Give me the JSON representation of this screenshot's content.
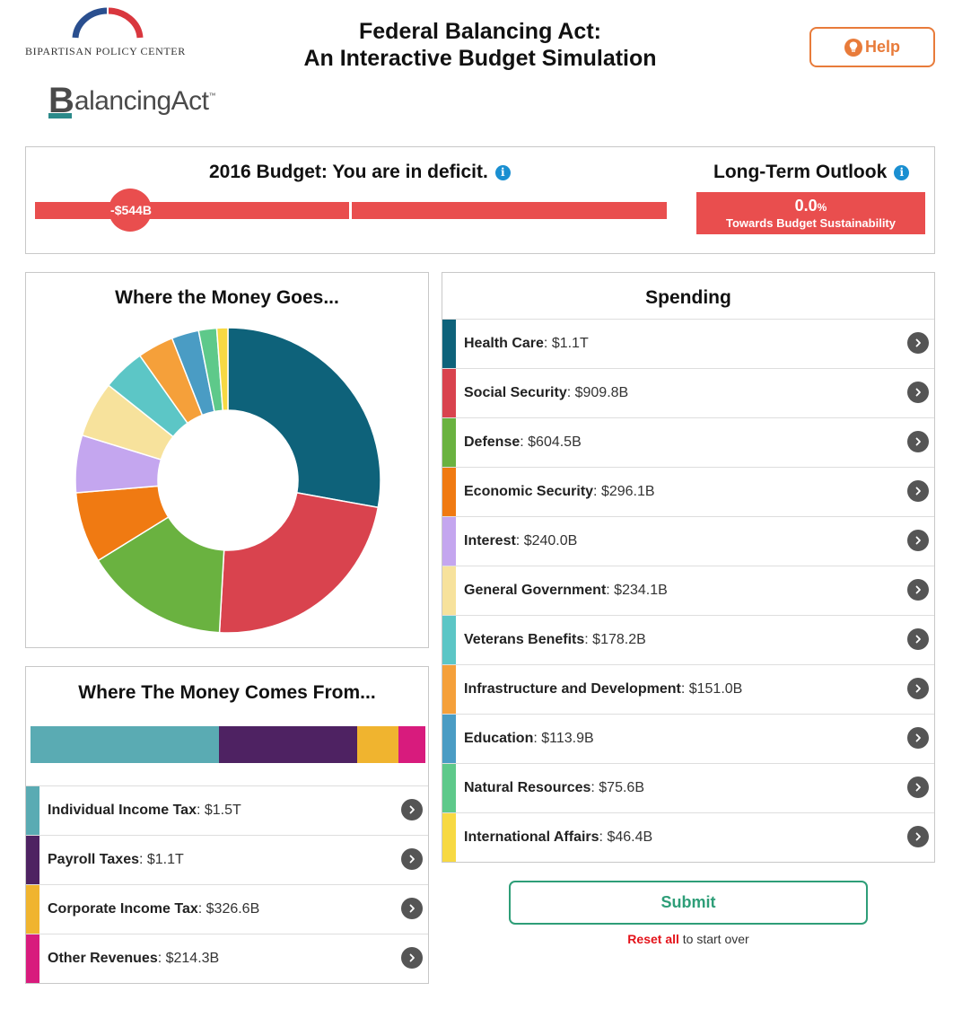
{
  "header": {
    "org_name": "BIPARTISAN POLICY CENTER",
    "product_logo_text": "BalancingAct",
    "title_line1": "Federal Balancing Act:",
    "title_line2": "An Interactive Budget Simulation",
    "help_label": "Help",
    "help_icon": "lightbulb-icon",
    "colors": {
      "arc_blue": "#2a4f8f",
      "arc_red": "#d9373e",
      "help_orange": "#e87b3a"
    }
  },
  "budget": {
    "title": "2016 Budget: You are in deficit.",
    "deficit_label": "-$544B",
    "info_icon": "info-icon",
    "bar_color": "#e94e4e"
  },
  "outlook": {
    "title": "Long-Term Outlook",
    "value": "0.0",
    "unit": "%",
    "subtitle": "Towards Budget Sustainability",
    "info_icon": "info-icon"
  },
  "where_goes": {
    "title": "Where the Money Goes..."
  },
  "where_from": {
    "title": "Where The Money Comes From...",
    "items": [
      {
        "name": "Individual Income Tax",
        "amount": ": $1.5T",
        "color": "#5aabb3",
        "value": 1500
      },
      {
        "name": "Payroll Taxes",
        "amount": ": $1.1T",
        "color": "#4e2262",
        "value": 1100
      },
      {
        "name": "Corporate Income Tax",
        "amount": ": $326.6B",
        "color": "#f0b42f",
        "value": 326.6
      },
      {
        "name": "Other Revenues",
        "amount": ": $214.3B",
        "color": "#d81b7d",
        "value": 214.3
      }
    ]
  },
  "spending": {
    "title": "Spending",
    "items": [
      {
        "name": "Health Care",
        "amount": ": $1.1T",
        "color": "#0e627a",
        "value": 1100
      },
      {
        "name": "Social Security",
        "amount": ": $909.8B",
        "color": "#d9434e",
        "value": 909.8
      },
      {
        "name": "Defense",
        "amount": ": $604.5B",
        "color": "#6ab240",
        "value": 604.5
      },
      {
        "name": "Economic Security",
        "amount": ": $296.1B",
        "color": "#f07a12",
        "value": 296.1
      },
      {
        "name": "Interest",
        "amount": ": $240.0B",
        "color": "#c4a6ef",
        "value": 240.0
      },
      {
        "name": "General Government",
        "amount": ": $234.1B",
        "color": "#f7e29c",
        "value": 234.1
      },
      {
        "name": "Veterans Benefits",
        "amount": ": $178.2B",
        "color": "#5cc6c6",
        "value": 178.2
      },
      {
        "name": "Infrastructure and Development",
        "amount": ": $151.0B",
        "color": "#f5a03a",
        "value": 151.0
      },
      {
        "name": "Education",
        "amount": ": $113.9B",
        "color": "#4a9cc4",
        "value": 113.9
      },
      {
        "name": "Natural Resources",
        "amount": ": $75.6B",
        "color": "#5ec98a",
        "value": 75.6
      },
      {
        "name": "International Affairs",
        "amount": ": $46.4B",
        "color": "#f7d943",
        "value": 46.4
      }
    ]
  },
  "actions": {
    "submit_label": "Submit",
    "reset_label": "Reset all",
    "reset_suffix": " to start over"
  }
}
